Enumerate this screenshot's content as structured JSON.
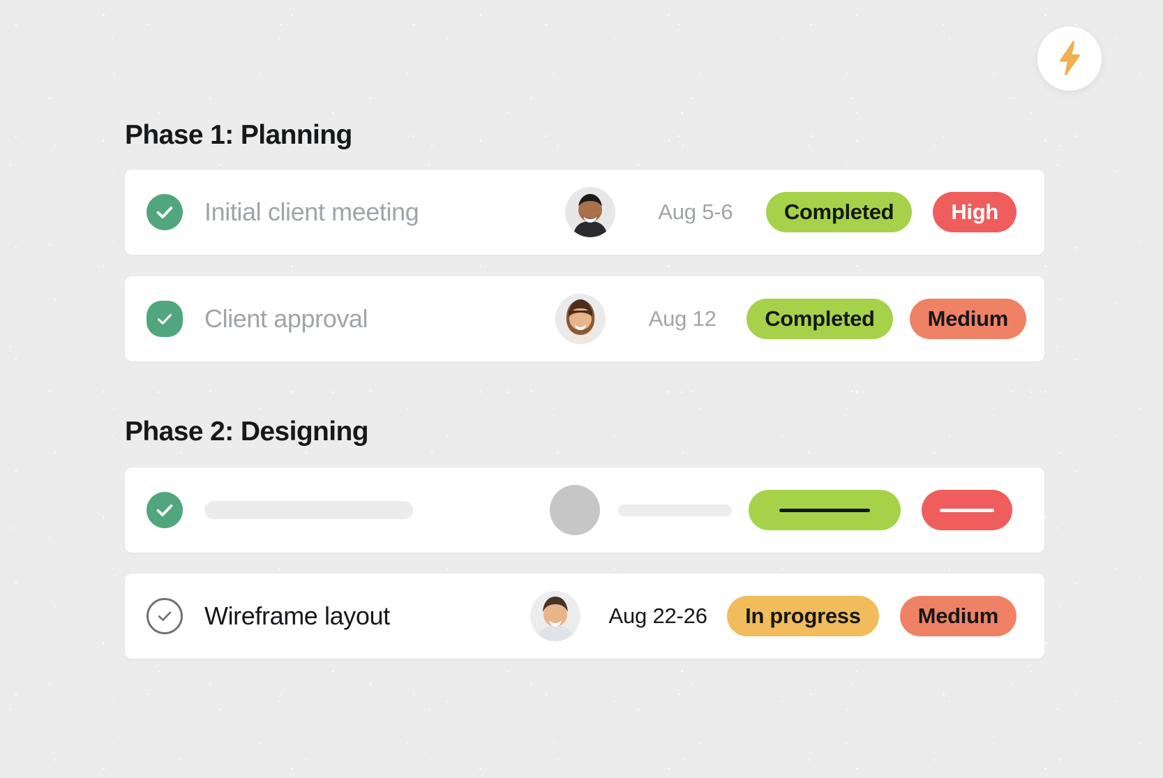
{
  "toolbar": {
    "bolt_button": {
      "icon": "lightning-bolt-icon",
      "icon_color": "#f0b04e",
      "background": "#ffffff"
    }
  },
  "colors": {
    "canvas": "#ececec",
    "card": "#ffffff",
    "check_green": "#51a67e",
    "badge_green": "#a6d24a",
    "badge_red": "#ef5d5d",
    "badge_salmon": "#ef8265",
    "badge_amber": "#f0bc5c",
    "text_dark": "#15171a",
    "text_muted": "#a0a4a8",
    "skeleton_gray": "#ececec",
    "skeleton_avatar": "#c6c6c6"
  },
  "phases": [
    {
      "title": "Phase 1: Planning",
      "tasks": [
        {
          "checked": true,
          "check_style": "circle",
          "title": "Initial client meeting",
          "title_style": "muted",
          "avatar": "avatar-man-beard",
          "date": "Aug 5-6",
          "date_style": "muted",
          "status": {
            "label": "Completed",
            "bg": "#a6d24a",
            "fg": "#15171a"
          },
          "priority": {
            "label": "High",
            "bg": "#ef5d5d",
            "fg": "#ffffff"
          }
        },
        {
          "checked": true,
          "check_style": "squircle",
          "title": "Client approval",
          "title_style": "muted",
          "avatar": "avatar-woman-bangs",
          "date": "Aug 12",
          "date_style": "muted",
          "status": {
            "label": "Completed",
            "bg": "#a6d24a",
            "fg": "#15171a"
          },
          "priority": {
            "label": "Medium",
            "bg": "#ef8265",
            "fg": "#15171a"
          }
        }
      ]
    },
    {
      "title": "Phase 2: Designing",
      "tasks": [
        {
          "checked": true,
          "check_style": "circle",
          "skeleton": true,
          "title": "",
          "avatar": "avatar-placeholder",
          "date": "",
          "status": {
            "label": "",
            "bg": "#a6d24a",
            "fg": "#15171a"
          },
          "priority": {
            "label": "",
            "bg": "#ef5d5d",
            "fg": "#ffffff"
          }
        },
        {
          "checked": false,
          "check_style": "outline",
          "title": "Wireframe layout",
          "title_style": "dark",
          "avatar": "avatar-man-short-hair",
          "date": "Aug 22-26",
          "date_style": "dark",
          "status": {
            "label": "In progress",
            "bg": "#f0bc5c",
            "fg": "#15171a"
          },
          "priority": {
            "label": "Medium",
            "bg": "#ef8265",
            "fg": "#15171a"
          }
        }
      ]
    }
  ]
}
